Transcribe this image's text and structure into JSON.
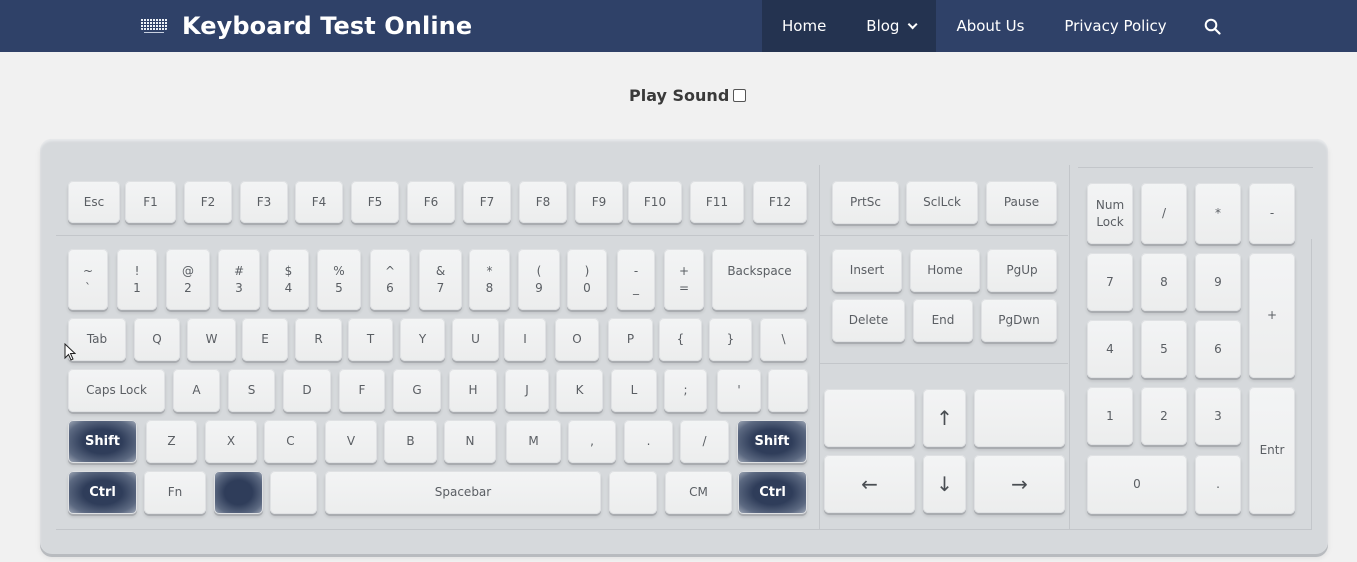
{
  "header": {
    "brand_icon": "keyboard-icon",
    "title": "Keyboard Test Online",
    "nav": [
      {
        "label": "Home"
      },
      {
        "label": "Blog",
        "icon": "chevron-down-icon"
      },
      {
        "label": "About Us"
      },
      {
        "label": "Privacy Policy"
      }
    ],
    "search_icon": "search-icon"
  },
  "play_sound": {
    "label": "Play Sound",
    "checked": false
  },
  "keyboard": {
    "function_row": [
      "Esc",
      "F1",
      "F2",
      "F3",
      "F4",
      "F5",
      "F6",
      "F7",
      "F8",
      "F9",
      "F10",
      "F11",
      "F12"
    ],
    "number_row": [
      {
        "top": "~",
        "bottom": "`"
      },
      {
        "top": "!",
        "bottom": "1"
      },
      {
        "top": "@",
        "bottom": "2"
      },
      {
        "top": "#",
        "bottom": "3"
      },
      {
        "top": "$",
        "bottom": "4"
      },
      {
        "top": "%",
        "bottom": "5"
      },
      {
        "top": "^",
        "bottom": "6"
      },
      {
        "top": "&",
        "bottom": "7"
      },
      {
        "top": "*",
        "bottom": "8"
      },
      {
        "top": "(",
        "bottom": "9"
      },
      {
        "top": ")",
        "bottom": "0"
      },
      {
        "top": "-",
        "bottom": "_"
      },
      {
        "top": "+",
        "bottom": "="
      },
      {
        "top": "Backspace",
        "bottom": ""
      }
    ],
    "tab_row": [
      "Tab",
      "Q",
      "W",
      "E",
      "R",
      "T",
      "Y",
      "U",
      "I",
      "O",
      "P",
      "{",
      "}",
      "\\"
    ],
    "caps_row": [
      "Caps Lock",
      "A",
      "S",
      "D",
      "F",
      "G",
      "H",
      "J",
      "K",
      "L",
      ";",
      "'",
      ""
    ],
    "shift_row": [
      "Shift",
      "Z",
      "X",
      "C",
      "V",
      "B",
      "N",
      "M",
      ",",
      ".",
      "/",
      "Shift"
    ],
    "bottom_row": [
      "Ctrl",
      "Fn",
      "",
      "",
      "Spacebar",
      "",
      "CM",
      "Ctrl"
    ],
    "pressed_keys": [
      "Shift-left",
      "Ctrl-left",
      "Win-left",
      "Shift-right",
      "Ctrl-right"
    ],
    "system_keys": [
      "PrtSc",
      "SclLck",
      "Pause"
    ],
    "nav_keys": [
      [
        "Insert",
        "Home",
        "PgUp"
      ],
      [
        "Delete",
        "End",
        "PgDwn"
      ]
    ],
    "arrow_keys": {
      "up": "↑",
      "left": "←",
      "down": "↓",
      "right": "→",
      "blank_left": "",
      "blank_right": ""
    },
    "numpad": {
      "row1": [
        {
          "top": "Num",
          "bottom": "Lock"
        },
        "/",
        "*",
        "-"
      ],
      "row2": [
        "7",
        "8",
        "9"
      ],
      "row3": [
        "4",
        "5",
        "6"
      ],
      "row4": [
        "1",
        "2",
        "3"
      ],
      "row5": [
        "0",
        "."
      ],
      "plus": "+",
      "enter": "Entr"
    }
  },
  "colors": {
    "header_bg": "#2f4168",
    "nav_active_bg": "#243350",
    "pressed_key": "#2f3d5a",
    "key_face": "#eeeff0",
    "case": "#d6d9dc"
  }
}
